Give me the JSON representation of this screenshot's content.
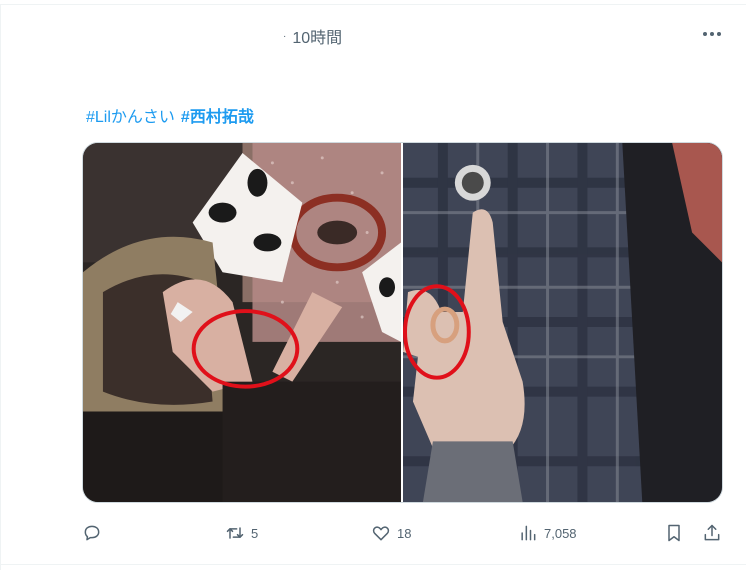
{
  "tweet": {
    "timestamp": "10時間",
    "hashtags": [
      "#Lilかんさい",
      "#西村拓哉"
    ],
    "actions": {
      "retweet_count": "5",
      "like_count": "18",
      "views_count": "7,058"
    }
  },
  "icons": [
    "more-icon",
    "reply-icon",
    "retweet-icon",
    "like-icon",
    "views-icon",
    "bookmark-icon",
    "share-icon"
  ],
  "colors": {
    "link": "#1d9bf0",
    "muted": "#536471",
    "annotation_circle": "#e0101a"
  }
}
